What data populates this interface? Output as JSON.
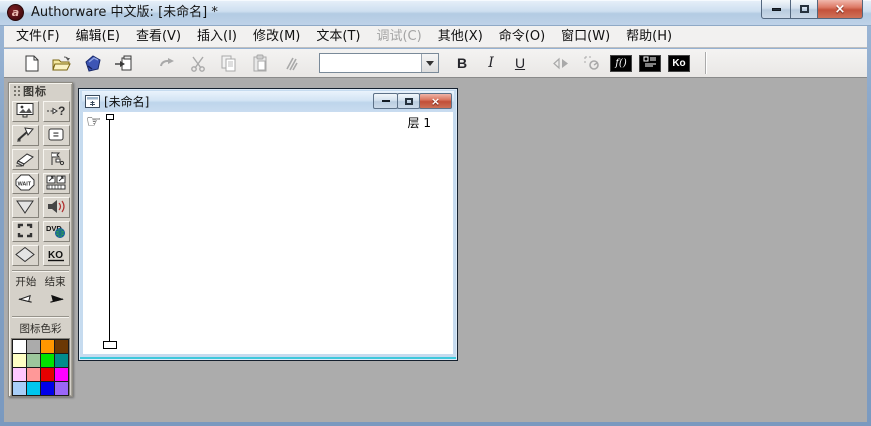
{
  "window": {
    "title": "Authorware 中文版: [未命名] *",
    "app_icon": "authorware-logo"
  },
  "menu": {
    "items": [
      {
        "label": "文件(F)",
        "enabled": true
      },
      {
        "label": "编辑(E)",
        "enabled": true
      },
      {
        "label": "查看(V)",
        "enabled": true
      },
      {
        "label": "插入(I)",
        "enabled": true
      },
      {
        "label": "修改(M)",
        "enabled": true
      },
      {
        "label": "文本(T)",
        "enabled": true
      },
      {
        "label": "调试(C)",
        "enabled": false
      },
      {
        "label": "其他(X)",
        "enabled": true
      },
      {
        "label": "命令(O)",
        "enabled": true
      },
      {
        "label": "窗口(W)",
        "enabled": true
      },
      {
        "label": "帮助(H)",
        "enabled": true
      }
    ]
  },
  "toolbar": {
    "file_buttons": [
      {
        "name": "new-file-button",
        "icon": "new-document-icon",
        "enabled": true
      },
      {
        "name": "open-file-button",
        "icon": "open-folder-icon",
        "enabled": true
      },
      {
        "name": "publish-button",
        "icon": "publish-package-icon",
        "enabled": true
      },
      {
        "name": "import-button",
        "icon": "import-icon",
        "enabled": true
      }
    ],
    "edit_buttons": [
      {
        "name": "undo-button",
        "icon": "undo-arrow-icon",
        "enabled": false
      },
      {
        "name": "cut-button",
        "icon": "scissors-icon",
        "enabled": false
      },
      {
        "name": "copy-button",
        "icon": "copy-pages-icon",
        "enabled": false
      },
      {
        "name": "paste-button",
        "icon": "clipboard-icon",
        "enabled": false
      },
      {
        "name": "text-styles-button",
        "icon": "text-styles-icon",
        "enabled": false
      }
    ],
    "style_combobox": {
      "value": ""
    },
    "format_buttons": [
      {
        "name": "bold-button",
        "label": "B"
      },
      {
        "name": "italic-button",
        "label": "I"
      },
      {
        "name": "underline-button",
        "label": "U"
      }
    ],
    "run_buttons": [
      {
        "name": "run-button",
        "icon": "play-icon",
        "enabled": false
      },
      {
        "name": "control-panel-button",
        "icon": "control-panel-icon",
        "enabled": false
      }
    ],
    "panel_buttons": [
      {
        "name": "functions-button",
        "label": "f()",
        "icon": "functions-icon"
      },
      {
        "name": "variables-button",
        "label": "",
        "icon": "variables-icon"
      },
      {
        "name": "knowledge-objects-button",
        "label": "Ko",
        "icon": "knowledge-objects-icon"
      }
    ]
  },
  "icon_palette": {
    "title": "图标",
    "icons": [
      {
        "name": "display-icon",
        "label": ""
      },
      {
        "name": "interaction-icon",
        "label": "?"
      },
      {
        "name": "motion-icon",
        "label": ""
      },
      {
        "name": "calculation-icon",
        "label": "="
      },
      {
        "name": "erase-icon",
        "label": ""
      },
      {
        "name": "map-icon",
        "label": ""
      },
      {
        "name": "wait-icon",
        "label": "WAIT"
      },
      {
        "name": "digital-movie-icon",
        "label": ""
      },
      {
        "name": "navigate-icon",
        "label": ""
      },
      {
        "name": "sound-icon",
        "label": ""
      },
      {
        "name": "framework-icon",
        "label": ""
      },
      {
        "name": "dvd-icon",
        "label": "DVD"
      },
      {
        "name": "decision-icon",
        "label": ""
      },
      {
        "name": "knowledge-object-icon",
        "label": "KO"
      }
    ],
    "flags": {
      "start_label": "开始",
      "end_label": "结束"
    },
    "colors": {
      "title": "图标色彩",
      "swatches": [
        "#FFFFFF",
        "#ABABAB",
        "#FF9700",
        "#6B3804",
        "#FFFFC4",
        "#9CC79C",
        "#00E400",
        "#008C8C",
        "#FFC8FF",
        "#FF9898",
        "#E60000",
        "#FF00FF",
        "#A8CEF8",
        "#00C6EE",
        "#0000EA",
        "#9B66F8"
      ],
      "selected_index": 0
    }
  },
  "design_window": {
    "title": "[未命名]",
    "layer_label": "层 1"
  },
  "theme": {
    "frame_blue": "#7A99BF",
    "mdi_background": "#ACACAC",
    "close_red": "#C4523B",
    "palette_gray": "#D5D1C9"
  }
}
